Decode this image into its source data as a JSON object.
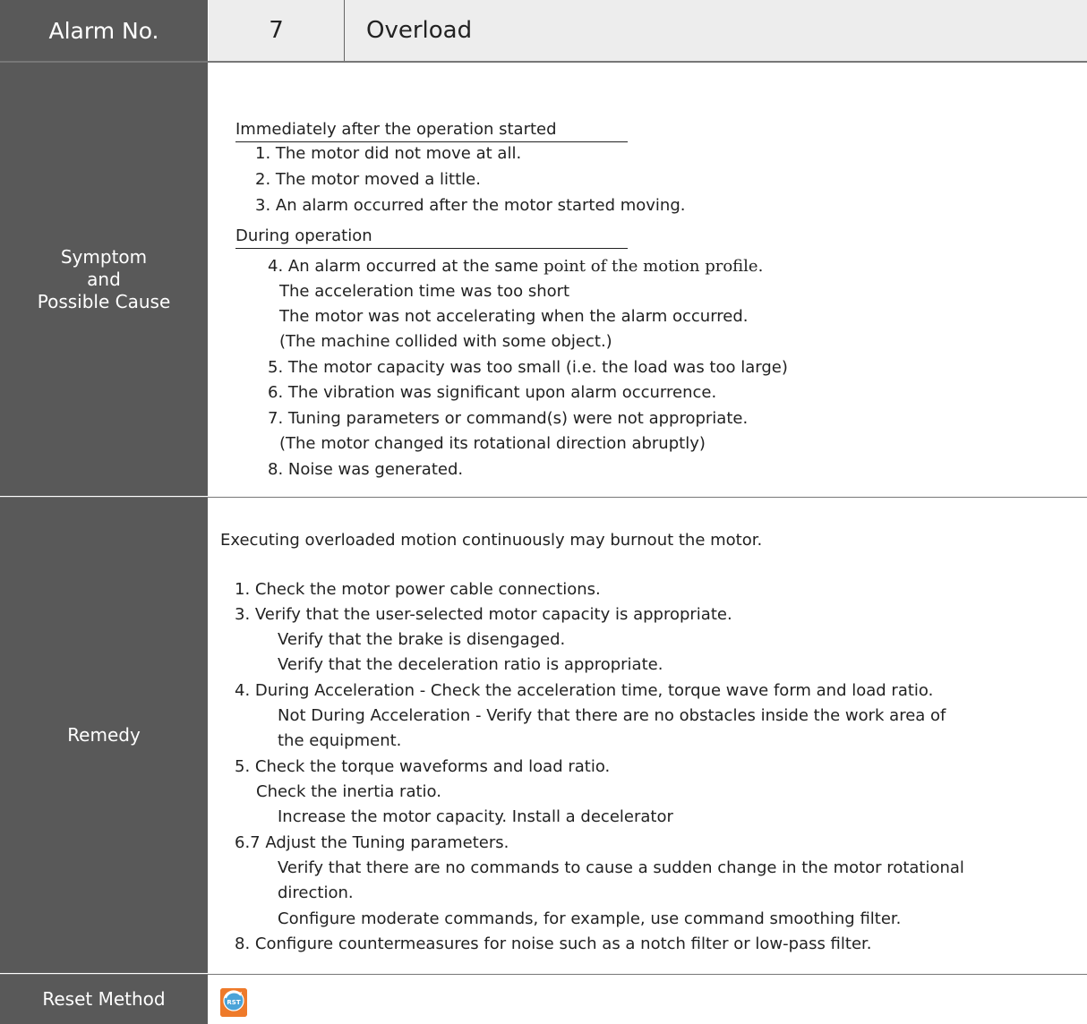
{
  "header": {
    "label": "Alarm No.",
    "number": "7",
    "name": "Overload"
  },
  "symptom": {
    "label_lines": [
      "Symptom",
      "and",
      "Possible Cause"
    ],
    "section1_title": "Immediately after the operation started",
    "section1_items": [
      "1. The motor did not move at all.",
      "2. The motor moved a little.",
      "3. An alarm occurred after the motor started moving."
    ],
    "section2_title": "During operation",
    "section2_item4_prefix": "4. An alarm occurred at the same ",
    "section2_item4_suffix": "point of the motion profile.",
    "section2_lines": [
      "The acceleration time was too short",
      "The motor was not accelerating when the alarm occurred.",
      "(The machine collided with some object.)",
      "5. The motor capacity was too small (i.e. the load was too large)",
      "6. The vibration was significant upon alarm occurrence.",
      "7. Tuning parameters or command(s) were not appropriate.",
      "(The motor changed its rotational direction abruptly)",
      "8. Noise was generated."
    ]
  },
  "remedy": {
    "label": "Remedy",
    "warning": "Executing overloaded motion continuously may burnout the motor.",
    "lines": [
      "1.  Check the motor power cable connections.",
      "3.   Verify that the user-selected motor capacity is appropriate.",
      "Verify that the brake is disengaged.",
      "Verify that the deceleration ratio is appropriate.",
      "4. During Acceleration - Check the acceleration time, torque wave form and load ratio.",
      "Not During Acceleration - Verify that there are no obstacles inside the work area of",
      "the equipment.",
      "5. Check the torque waveforms and load ratio.",
      "Check the inertia ratio.",
      "Increase the motor capacity. Install a decelerator",
      "6.7 Adjust the Tuning parameters.",
      "Verify that there are no commands to cause a sudden change in the motor rotational",
      "direction.",
      "Configure moderate commands, for example, use command smoothing filter.",
      "8. Configure countermeasures for noise such as a notch filter or low-pass filter."
    ]
  },
  "reset": {
    "label": "Reset Method",
    "icon": "reset-rst-icon",
    "icon_text": "RST"
  }
}
